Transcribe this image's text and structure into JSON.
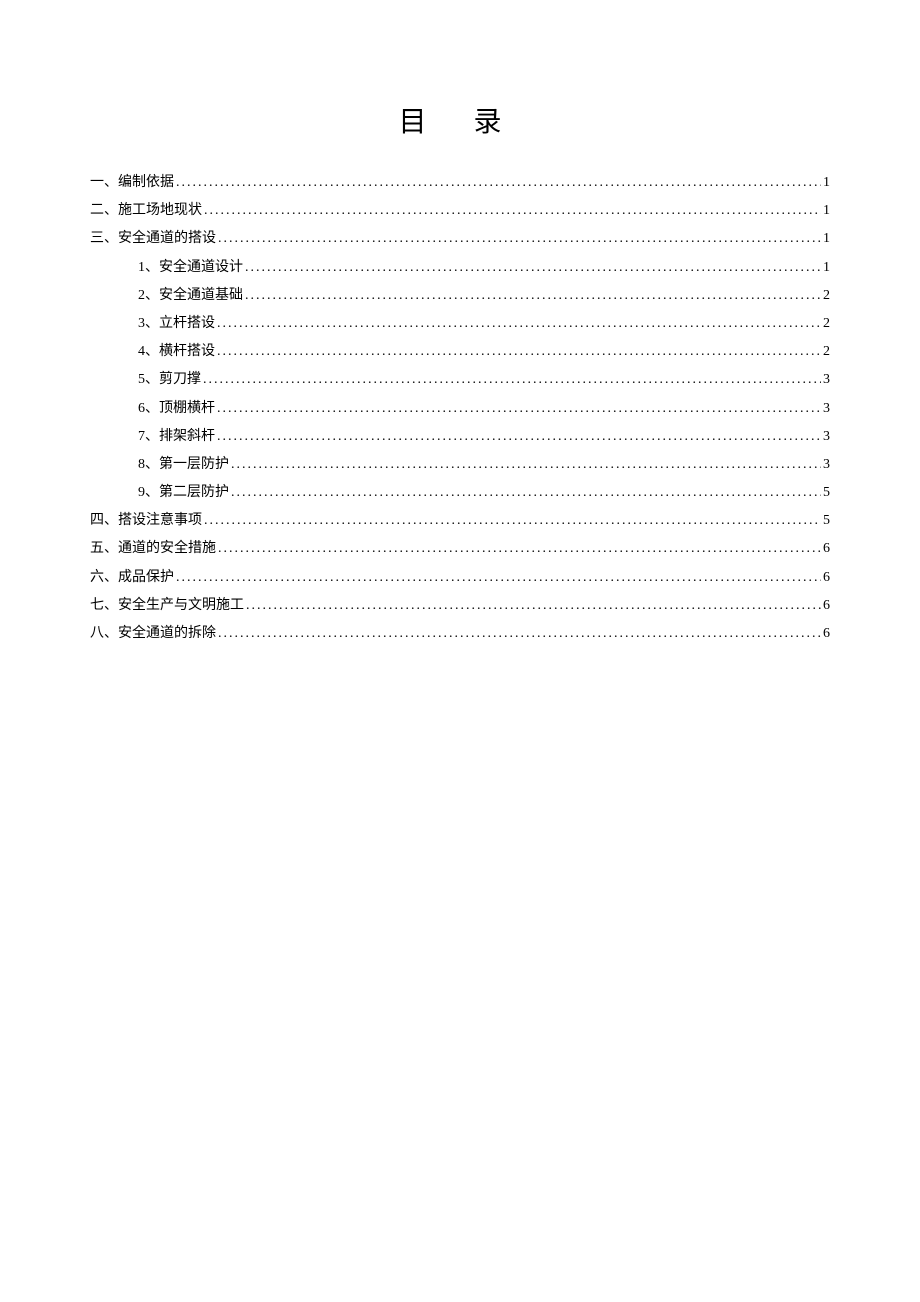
{
  "title": "目 录",
  "entries": [
    {
      "level": 1,
      "label": "一、编制依据",
      "page": "1"
    },
    {
      "level": 1,
      "label": "二、施工场地现状",
      "page": "1"
    },
    {
      "level": 1,
      "label": "三、安全通道的搭设",
      "page": "1"
    },
    {
      "level": 2,
      "label": "1、安全通道设计",
      "page": "1"
    },
    {
      "level": 2,
      "label": "2、安全通道基础",
      "page": "2"
    },
    {
      "level": 2,
      "label": "3、立杆搭设",
      "page": "2"
    },
    {
      "level": 2,
      "label": "4、横杆搭设",
      "page": "2"
    },
    {
      "level": 2,
      "label": "5、剪刀撑",
      "page": "3"
    },
    {
      "level": 2,
      "label": "6、顶棚横杆",
      "page": "3"
    },
    {
      "level": 2,
      "label": "7、排架斜杆",
      "page": "3"
    },
    {
      "level": 2,
      "label": "8、第一层防护",
      "page": "3"
    },
    {
      "level": 2,
      "label": "9、第二层防护",
      "page": "5"
    },
    {
      "level": 1,
      "label": "四、搭设注意事项",
      "page": "5"
    },
    {
      "level": 1,
      "label": "五、通道的安全措施",
      "page": "6"
    },
    {
      "level": 1,
      "label": "六、成品保护",
      "page": "6"
    },
    {
      "level": 1,
      "label": "七、安全生产与文明施工",
      "page": "6"
    },
    {
      "level": 1,
      "label": "八、安全通道的拆除",
      "page": "6"
    }
  ]
}
